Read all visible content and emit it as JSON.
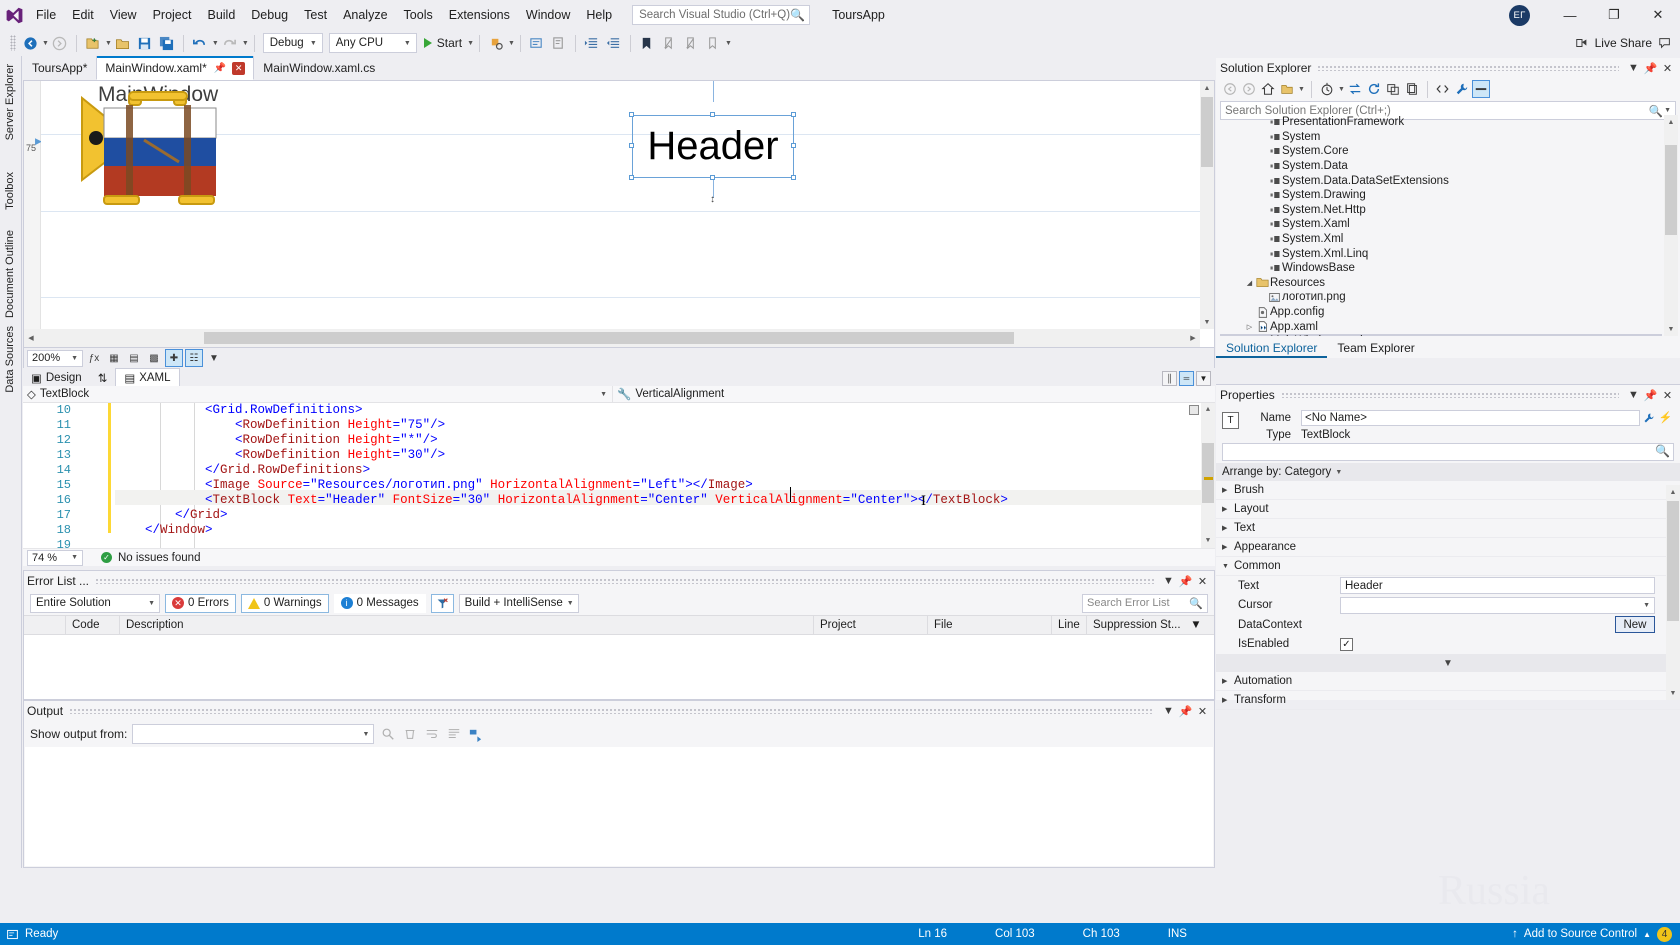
{
  "titlebar": {
    "menu": [
      "File",
      "Edit",
      "View",
      "Project",
      "Build",
      "Debug",
      "Test",
      "Analyze",
      "Tools",
      "Extensions",
      "Window",
      "Help"
    ],
    "search_placeholder": "Search Visual Studio (Ctrl+Q)",
    "solution_name": "ToursApp",
    "avatar_initials": "ЕГ",
    "minimize": "—",
    "maximize": "❐",
    "close": "✕"
  },
  "toolbar": {
    "config": "Debug",
    "platform": "Any CPU",
    "start_label": "Start",
    "live_share": "Live Share"
  },
  "left_tabs": [
    "Server Explorer",
    "Toolbox",
    "Document Outline",
    "Data Sources"
  ],
  "doc_tabs": [
    {
      "label": "ToursApp*",
      "state": "inactive"
    },
    {
      "label": "MainWindow.xaml*",
      "state": "active"
    },
    {
      "label": "MainWindow.xaml.cs",
      "state": "inactive"
    }
  ],
  "designer": {
    "window_title": "MainWindow",
    "header_text": "Header",
    "ruler_label": "75",
    "zoom": "200%"
  },
  "split_tabs": {
    "design": "Design",
    "swap_icon": "⇅",
    "xaml": "XAML"
  },
  "editor": {
    "nav_left": "TextBlock",
    "nav_right": "VerticalAlignment",
    "zoom": "74 %",
    "issues": "No issues found",
    "lines": [
      {
        "num": "10",
        "segments": [
          {
            "t": "            ",
            "c": "plain"
          },
          {
            "t": "<Grid.RowDefinitions>",
            "c": "tag"
          }
        ]
      },
      {
        "num": "11",
        "segments": [
          {
            "t": "                ",
            "c": "plain"
          },
          {
            "t": "<",
            "c": "br"
          },
          {
            "t": "RowDefinition",
            "c": "elem"
          },
          {
            "t": " ",
            "c": "plain"
          },
          {
            "t": "Height",
            "c": "attr"
          },
          {
            "t": "=",
            "c": "br"
          },
          {
            "t": "\"75\"",
            "c": "val"
          },
          {
            "t": "/>",
            "c": "br"
          }
        ]
      },
      {
        "num": "12",
        "segments": [
          {
            "t": "                ",
            "c": "plain"
          },
          {
            "t": "<",
            "c": "br"
          },
          {
            "t": "RowDefinition",
            "c": "elem"
          },
          {
            "t": " ",
            "c": "plain"
          },
          {
            "t": "Height",
            "c": "attr"
          },
          {
            "t": "=",
            "c": "br"
          },
          {
            "t": "\"*\"",
            "c": "val"
          },
          {
            "t": "/>",
            "c": "br"
          }
        ]
      },
      {
        "num": "13",
        "segments": [
          {
            "t": "                ",
            "c": "plain"
          },
          {
            "t": "<",
            "c": "br"
          },
          {
            "t": "RowDefinition",
            "c": "elem"
          },
          {
            "t": " ",
            "c": "plain"
          },
          {
            "t": "Height",
            "c": "attr"
          },
          {
            "t": "=",
            "c": "br"
          },
          {
            "t": "\"30\"",
            "c": "val"
          },
          {
            "t": "/>",
            "c": "br"
          }
        ]
      },
      {
        "num": "14",
        "segments": [
          {
            "t": "            ",
            "c": "plain"
          },
          {
            "t": "</",
            "c": "br"
          },
          {
            "t": "Grid.RowDefinitions",
            "c": "elem"
          },
          {
            "t": ">",
            "c": "br"
          }
        ]
      },
      {
        "num": "15",
        "segments": [
          {
            "t": "            ",
            "c": "plain"
          },
          {
            "t": "<",
            "c": "br"
          },
          {
            "t": "Image",
            "c": "elem"
          },
          {
            "t": " ",
            "c": "plain"
          },
          {
            "t": "Source",
            "c": "attr"
          },
          {
            "t": "=",
            "c": "br"
          },
          {
            "t": "\"Resources/логотип.png\"",
            "c": "val"
          },
          {
            "t": " ",
            "c": "plain"
          },
          {
            "t": "HorizontalAlignment",
            "c": "attr"
          },
          {
            "t": "=",
            "c": "br"
          },
          {
            "t": "\"Left\"",
            "c": "val"
          },
          {
            "t": "></",
            "c": "br"
          },
          {
            "t": "Image",
            "c": "elem"
          },
          {
            "t": ">",
            "c": "br"
          }
        ]
      },
      {
        "num": "16",
        "segments": [
          {
            "t": "            ",
            "c": "plain"
          },
          {
            "t": "<",
            "c": "br"
          },
          {
            "t": "TextBlock",
            "c": "elem"
          },
          {
            "t": " ",
            "c": "plain"
          },
          {
            "t": "Text",
            "c": "attr"
          },
          {
            "t": "=",
            "c": "br"
          },
          {
            "t": "\"Header\"",
            "c": "val"
          },
          {
            "t": " ",
            "c": "plain"
          },
          {
            "t": "FontSize",
            "c": "attr"
          },
          {
            "t": "=",
            "c": "br"
          },
          {
            "t": "\"30\"",
            "c": "val"
          },
          {
            "t": " ",
            "c": "plain"
          },
          {
            "t": "HorizontalAlignment",
            "c": "attr"
          },
          {
            "t": "=",
            "c": "br"
          },
          {
            "t": "\"Center\"",
            "c": "val"
          },
          {
            "t": " ",
            "c": "plain"
          },
          {
            "t": "VerticalAlignment",
            "c": "attr"
          },
          {
            "t": "=",
            "c": "br"
          },
          {
            "t": "\"Center\"",
            "c": "val"
          },
          {
            "t": "></",
            "c": "br"
          },
          {
            "t": "TextBlock",
            "c": "elem"
          },
          {
            "t": ">",
            "c": "br"
          }
        ]
      },
      {
        "num": "17",
        "segments": [
          {
            "t": "        ",
            "c": "plain"
          },
          {
            "t": "</",
            "c": "br"
          },
          {
            "t": "Grid",
            "c": "elem"
          },
          {
            "t": ">",
            "c": "br"
          }
        ]
      },
      {
        "num": "18",
        "segments": [
          {
            "t": "    ",
            "c": "plain"
          },
          {
            "t": "</",
            "c": "br"
          },
          {
            "t": "Window",
            "c": "elem"
          },
          {
            "t": ">",
            "c": "br"
          }
        ]
      },
      {
        "num": "19",
        "segments": []
      }
    ]
  },
  "error_list": {
    "title": "Error List ...",
    "scope": "Entire Solution",
    "errors": "0 Errors",
    "warnings": "0 Warnings",
    "messages": "0 Messages",
    "build_filter": "Build + IntelliSense",
    "search_placeholder": "Search Error List",
    "columns": [
      "",
      "Code",
      "Description",
      "Project",
      "File",
      "Line",
      "Suppression St..."
    ]
  },
  "output": {
    "title": "Output",
    "show_label": "Show output from:",
    "source": ""
  },
  "solution_explorer": {
    "title": "Solution Explorer",
    "search_placeholder": "Search Solution Explorer (Ctrl+;)",
    "tree": [
      {
        "label": "PresentationFramework",
        "icon": "reference",
        "indent": 3,
        "twist": ""
      },
      {
        "label": "System",
        "icon": "reference",
        "indent": 3,
        "twist": ""
      },
      {
        "label": "System.Core",
        "icon": "reference",
        "indent": 3,
        "twist": ""
      },
      {
        "label": "System.Data",
        "icon": "reference",
        "indent": 3,
        "twist": ""
      },
      {
        "label": "System.Data.DataSetExtensions",
        "icon": "reference",
        "indent": 3,
        "twist": ""
      },
      {
        "label": "System.Drawing",
        "icon": "reference",
        "indent": 3,
        "twist": ""
      },
      {
        "label": "System.Net.Http",
        "icon": "reference",
        "indent": 3,
        "twist": ""
      },
      {
        "label": "System.Xaml",
        "icon": "reference",
        "indent": 3,
        "twist": ""
      },
      {
        "label": "System.Xml",
        "icon": "reference",
        "indent": 3,
        "twist": ""
      },
      {
        "label": "System.Xml.Linq",
        "icon": "reference",
        "indent": 3,
        "twist": ""
      },
      {
        "label": "WindowsBase",
        "icon": "reference",
        "indent": 3,
        "twist": ""
      },
      {
        "label": "Resources",
        "icon": "folder",
        "indent": 2,
        "twist": "◢"
      },
      {
        "label": "логотип.png",
        "icon": "image",
        "indent": 3,
        "twist": ""
      },
      {
        "label": "App.config",
        "icon": "config",
        "indent": 2,
        "twist": ""
      },
      {
        "label": "App.xaml",
        "icon": "xaml",
        "indent": 2,
        "twist": "▷"
      },
      {
        "label": "MainWindow.xaml",
        "icon": "xaml",
        "indent": 2,
        "twist": "▷",
        "selected": true
      }
    ],
    "tabs": [
      {
        "label": "Solution Explorer",
        "active": true
      },
      {
        "label": "Team Explorer",
        "active": false
      }
    ]
  },
  "properties": {
    "title": "Properties",
    "name_label": "Name",
    "name_value": "<No Name>",
    "type_label": "Type",
    "type_value": "TextBlock",
    "arrange_by": "Arrange by: Category",
    "categories": [
      {
        "label": "Brush",
        "expanded": false
      },
      {
        "label": "Layout",
        "expanded": false
      },
      {
        "label": "Text",
        "expanded": false
      },
      {
        "label": "Appearance",
        "expanded": false
      },
      {
        "label": "Common",
        "expanded": true
      }
    ],
    "common_rows": [
      {
        "name": "Text",
        "value": "Header",
        "kind": "text"
      },
      {
        "name": "Cursor",
        "value": "",
        "kind": "dropdown"
      },
      {
        "name": "DataContext",
        "value": "New",
        "kind": "button"
      },
      {
        "name": "IsEnabled",
        "value": "✓",
        "kind": "checkbox"
      }
    ],
    "more_categories": [
      {
        "label": "Automation",
        "expanded": false
      },
      {
        "label": "Transform",
        "expanded": false
      }
    ]
  },
  "statusbar": {
    "ready": "Ready",
    "line": "Ln 16",
    "col": "Col 103",
    "ch": "Ch 103",
    "ins": "INS",
    "source_control": "Add to Source Control",
    "notification_count": "4"
  },
  "watermark": "Russia"
}
